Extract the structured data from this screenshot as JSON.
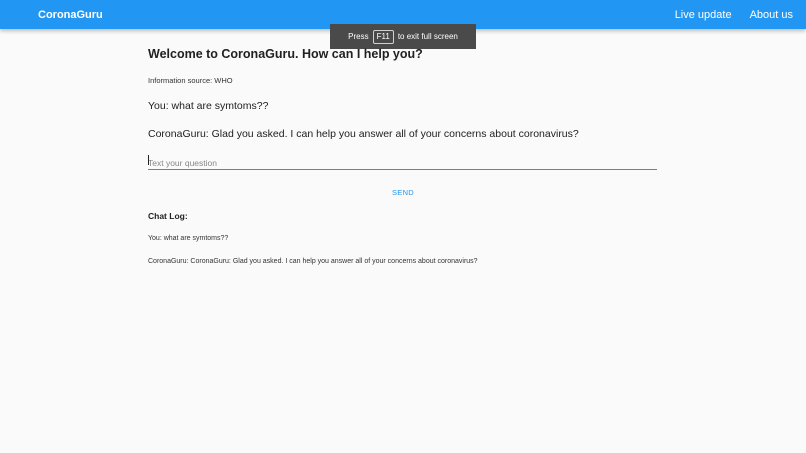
{
  "header": {
    "brand": "CoronaGuru",
    "nav": [
      {
        "label": "Live update"
      },
      {
        "label": "About us"
      }
    ],
    "color": "#2196f3"
  },
  "fullscreen_toast": {
    "prefix": "Press",
    "key": "F11",
    "suffix": "to exit full screen"
  },
  "chat": {
    "title": "Welcome to CoronaGuru. How can I help you?",
    "source": "Information source: WHO",
    "user_message": "You: what are symtoms??",
    "bot_message": "CoronaGuru: Glad you asked. I can help you answer all of your concerns about coronavirus?",
    "input": {
      "value": "",
      "placeholder": "Text your question"
    },
    "send_label": "SEND"
  },
  "log": {
    "heading": "Chat Log:",
    "entries": [
      "You: what are symtoms??",
      "CoronaGuru: CoronaGuru: Glad you asked. I can help you answer all of your concerns about coronavirus?"
    ]
  }
}
